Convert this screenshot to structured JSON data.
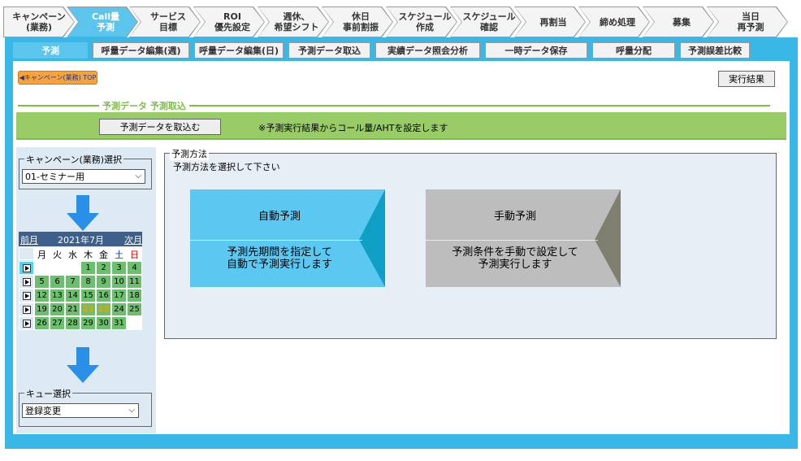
{
  "top_tabs": [
    {
      "label": "キャンペーン\n(業務)"
    },
    {
      "label": "Call量\n予測"
    },
    {
      "label": "サービス\n目標"
    },
    {
      "label": "ROI\n優先設定"
    },
    {
      "label": "週休、\n希望シフト"
    },
    {
      "label": "休日\n事前割振"
    },
    {
      "label": "スケジュール\n作成"
    },
    {
      "label": "スケジュール\n確認"
    },
    {
      "label": "再割当"
    },
    {
      "label": "締め処理"
    },
    {
      "label": "募集"
    },
    {
      "label": "当日\n再予測"
    }
  ],
  "sub_tabs": [
    {
      "label": "予測"
    },
    {
      "label": "呼量データ編集(週)"
    },
    {
      "label": "呼量データ編集(日)"
    },
    {
      "label": "予測データ取込"
    },
    {
      "label": "実績データ照会分析"
    },
    {
      "label": "一時データ保存"
    },
    {
      "label": "呼量分配"
    },
    {
      "label": "予測誤差比較"
    }
  ],
  "top_link": "◀キャンペーン(業務) TOP",
  "exec_result_button": "実行結果",
  "section_title": "予測データ 予測取込",
  "import_button": "予測データを取込む",
  "import_note": "※予測実行結果からコール量/AHTを設定します",
  "campaign": {
    "legend": "キャンペーン(業務)選択",
    "value": "01-セミナー用"
  },
  "calendar": {
    "prev": "前月",
    "next": "次月",
    "month": "2021年7月",
    "weekdays": [
      "月",
      "火",
      "水",
      "木",
      "金",
      "土",
      "日"
    ],
    "weeks": [
      [
        "",
        "",
        "",
        "1",
        "2",
        "3",
        "4"
      ],
      [
        "5",
        "6",
        "7",
        "8",
        "9",
        "10",
        "11"
      ],
      [
        "12",
        "13",
        "14",
        "15",
        "16",
        "17",
        "18"
      ],
      [
        "19",
        "20",
        "21",
        "22",
        "23",
        "24",
        "25"
      ],
      [
        "26",
        "27",
        "28",
        "29",
        "30",
        "31",
        ""
      ]
    ]
  },
  "queue": {
    "legend": "キュー選択",
    "value": "登録変更"
  },
  "method": {
    "legend": "予測方法",
    "instruction": "予測方法を選択して下さい",
    "auto": {
      "title": "自動予測",
      "desc": "予測先期間を指定して\n自動で予測実行します",
      "color": "#5bc8f2",
      "tip": "#0f9fc4"
    },
    "manual": {
      "title": "手動予測",
      "desc": "予測条件を手動で設定して\n予測実行します",
      "color": "#bdbdbd",
      "tip": "#7f7f70"
    }
  }
}
